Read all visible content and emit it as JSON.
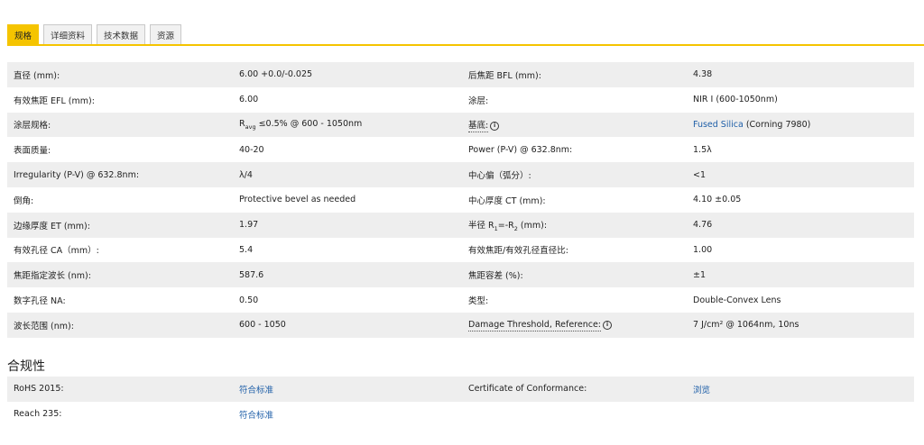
{
  "tabs": [
    "规格",
    "详细资料",
    "技术数据",
    "资源"
  ],
  "specs": [
    [
      "直径 (mm):",
      "6.00 +0.0/-0.025",
      "后焦距 BFL (mm):",
      "4.38"
    ],
    [
      "有效焦距 EFL (mm):",
      "6.00",
      "涂层:",
      "NIR I (600-1050nm)"
    ],
    [
      "涂层规格:",
      "",
      "基底:",
      ""
    ],
    [
      "表面质量:",
      "40-20",
      "Power (P-V) @ 632.8nm:",
      "1.5λ"
    ],
    [
      "Irregularity (P-V) @ 632.8nm:",
      "λ/4",
      "中心偏（弧分）:",
      "<1"
    ],
    [
      "倒角:",
      "Protective bevel as needed",
      "中心厚度 CT (mm):",
      "4.10 ±0.05"
    ],
    [
      "边缘厚度 ET (mm):",
      "1.97",
      "",
      "4.76"
    ],
    [
      "有效孔径 CA（mm）:",
      "5.4",
      "有效焦距/有效孔径直径比:",
      "1.00"
    ],
    [
      "焦距指定波长 (nm):",
      "587.6",
      "焦距容差 (%):",
      "±1"
    ],
    [
      "数字孔径 NA:",
      "0.50",
      "类型:",
      "Double-Convex Lens"
    ],
    [
      "波长范围 (nm):",
      "600 - 1050",
      "Damage Threshold, Reference:",
      "7 J/cm² @ 1064nm, 10ns"
    ]
  ],
  "coating_spec": {
    "r": "R",
    "sub": "avg",
    "rest": " ≤0.5% @ 600 - 1050nm"
  },
  "substrate": {
    "link": "Fused Silica",
    "rest": " (Corning 7980)"
  },
  "radius_label": {
    "a": "半径 R",
    "s1": "1",
    "b": "=-R",
    "s2": "2",
    "c": " (mm):"
  },
  "info_glyph": "i",
  "compliance": {
    "title": "合规性",
    "rows": [
      [
        "RoHS 2015:",
        "符合标准",
        "Certificate of Conformance:",
        "浏览"
      ],
      [
        "Reach 235:",
        "符合标准",
        "",
        ""
      ]
    ]
  }
}
